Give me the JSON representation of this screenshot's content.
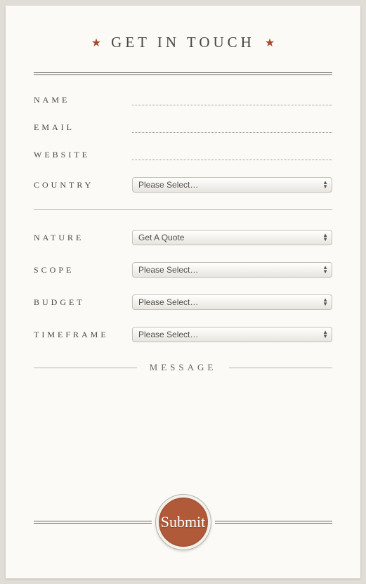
{
  "title": "GET IN TOUCH",
  "fields": {
    "name": {
      "label": "NAME"
    },
    "email": {
      "label": "EMAIL"
    },
    "website": {
      "label": "WEBSITE"
    },
    "country": {
      "label": "COUNTRY",
      "selected": "Please Select…"
    },
    "nature": {
      "label": "NATURE",
      "selected": "Get A Quote"
    },
    "scope": {
      "label": "SCOPE",
      "selected": "Please Select…"
    },
    "budget": {
      "label": "BUDGET",
      "selected": "Please Select…"
    },
    "timeframe": {
      "label": "TIMEFRAME",
      "selected": "Please Select…"
    }
  },
  "message_label": "MESSAGE",
  "submit_label": "Submit"
}
